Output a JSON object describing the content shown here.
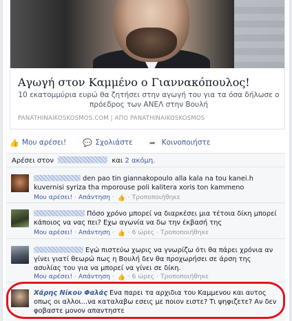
{
  "post": {
    "preview": {
      "title": "Αγωγή στον Καμμένο ο Γιαννακόπουλος!",
      "description": "10 εκατομμύρια ευρώ θα ζητήσει στην αγωγή του για τα όσα δήλωσε ο πρόεδρος των ΑΝΕΛ στην Βουλή",
      "source": "PANATHINAIKOSKOSMOS.COM | ΑΠΟ PANATHINAIKOSKOSMOS"
    },
    "actions": {
      "like_label": "Μου αρέσει!",
      "comment_label": "Σχολιάστε",
      "share_label": "Κοινοποιήστε"
    },
    "likes": {
      "prefix": "Αρέσει στον",
      "middle": "και",
      "others_link": "2 ακόμη."
    }
  },
  "comments": [
    {
      "text": "den pao tin giannakopoulo alla kala na tou kanei.h kuvernisi syriza tha mporouse poli kalitera xoris ton kammeno",
      "like": "Μου αρέσει!",
      "reply": "Απάντηση",
      "time": "",
      "edited": "Τροποποιήθηκε"
    },
    {
      "text": "Πόσο χρόνο μπορεί να διαρκέσει μια τέτοια δίκη μπορεί κάποιος να νας πει? Εχω αγωνία να δω την έκβασή της",
      "like": "Μου αρέσει!",
      "reply": "Απάντηση",
      "time": "6 ώρες",
      "edited": "Τροποποιήθηκε"
    },
    {
      "text": "Εγώ πιστεύω χωρις να γνωρίζω ότι θα πάρει χρόνια αν γίνει γιατί θεωρώ πως η Βουλή δεν θα προχωρήσει σε άρση της ασυλίας του για να μπορεί να γίνει σε δίκη.",
      "like": "Μου αρέσει!",
      "reply": "Απάντηση",
      "time": "6 ώρες",
      "edited": "Τροποποιήθηκε"
    },
    {
      "author": "Χάρης Νίκου Φαλάς",
      "text": "Ενα παρει τα αρχιδια του Καμμενου και αυτος οπως οι αλλοι...να καταλαβω εσεις με ποιον ειστε? Τι ψηφιζετε? Αν δεν φοβαστε μονον απαντηστε"
    }
  ],
  "icons": {
    "like": "thumbs-up-icon",
    "comment": "comment-bubble-icon",
    "share": "share-arrow-icon"
  },
  "colors": {
    "link": "#3b5998",
    "highlight": "#e0161c",
    "meta": "#9197a3"
  }
}
